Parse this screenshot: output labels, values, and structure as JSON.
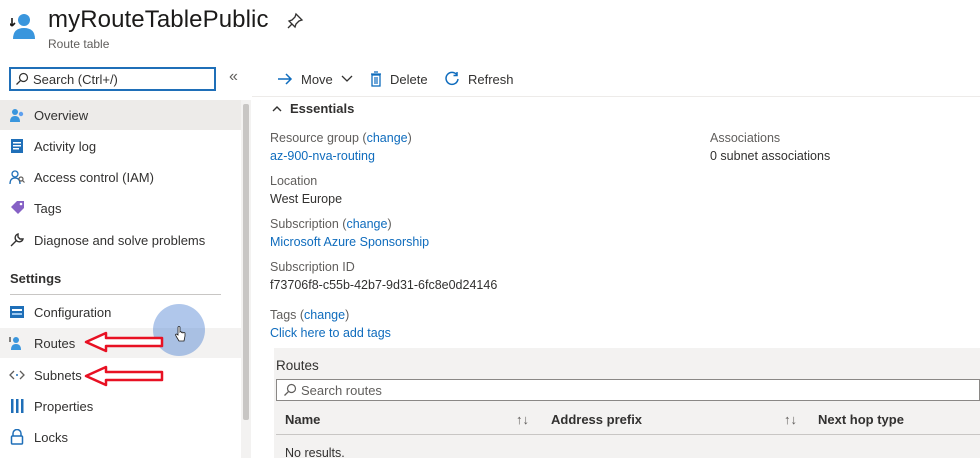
{
  "header": {
    "title": "myRouteTablePublic",
    "subtitle": "Route table"
  },
  "sidebar": {
    "search_placeholder": "Search (Ctrl+/)",
    "collapse_label": "«",
    "items": [
      {
        "label": "Overview",
        "icon": "overview-icon"
      },
      {
        "label": "Activity log",
        "icon": "activity-log-icon"
      },
      {
        "label": "Access control (IAM)",
        "icon": "iam-icon"
      },
      {
        "label": "Tags",
        "icon": "tag-icon"
      },
      {
        "label": "Diagnose and solve problems",
        "icon": "wrench-icon"
      }
    ],
    "section_title": "Settings",
    "settings_items": [
      {
        "label": "Configuration",
        "icon": "configuration-icon"
      },
      {
        "label": "Routes",
        "icon": "routes-icon"
      },
      {
        "label": "Subnets",
        "icon": "subnets-icon"
      },
      {
        "label": "Properties",
        "icon": "properties-icon"
      },
      {
        "label": "Locks",
        "icon": "lock-icon"
      }
    ]
  },
  "toolbar": {
    "move_label": "Move",
    "delete_label": "Delete",
    "refresh_label": "Refresh"
  },
  "essentials": {
    "title": "Essentials",
    "resource_group_label": "Resource group",
    "resource_group_change": "change",
    "resource_group_value": "az-900-nva-routing",
    "location_label": "Location",
    "location_value": "West Europe",
    "subscription_label": "Subscription",
    "subscription_change": "change",
    "subscription_value": "Microsoft Azure Sponsorship",
    "subscription_id_label": "Subscription ID",
    "subscription_id_value": "f73706f8-c55b-42b7-9d31-6fc8e0d24146",
    "tags_label": "Tags",
    "tags_change": "change",
    "tags_value": "Click here to add tags",
    "associations_label": "Associations",
    "associations_value": "0 subnet associations"
  },
  "routes": {
    "title": "Routes",
    "search_placeholder": "Search routes",
    "columns": [
      "Name",
      "Address prefix",
      "Next hop type"
    ],
    "empty_text": "No results."
  },
  "colors": {
    "accent": "#0f6cbd",
    "annotation_arrow": "#e81123"
  }
}
